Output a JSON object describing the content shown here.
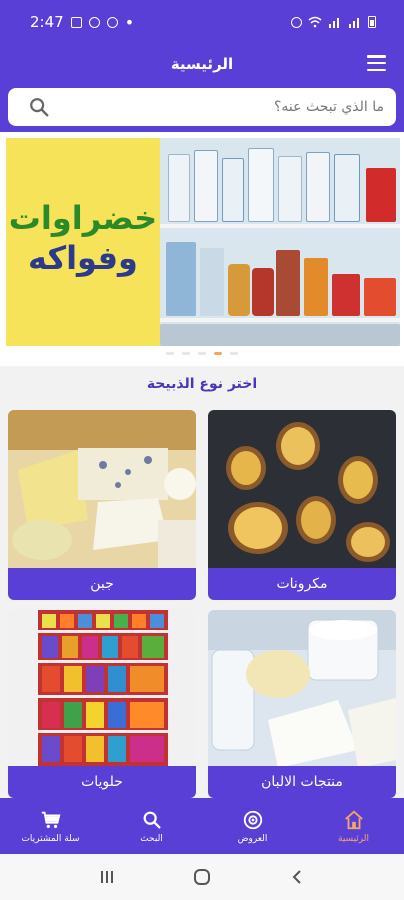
{
  "status_bar": {
    "time": "2:47"
  },
  "header": {
    "title": "الرئيسية"
  },
  "search": {
    "placeholder": "ما الذي تبحث عنه؟"
  },
  "banner": {
    "line1": "خضراوات",
    "line2": "وفواكه",
    "dots_count": 5,
    "active_dot": 4
  },
  "section": {
    "title": "اختر نوع الذبيحة",
    "categories": [
      {
        "label": "جبن"
      },
      {
        "label": "مكرونات"
      },
      {
        "label": "حلويات"
      },
      {
        "label": "منتجات الالبان"
      }
    ]
  },
  "bottom_nav": {
    "items": [
      {
        "label": "الرئيسية",
        "icon": "home-icon",
        "active": true
      },
      {
        "label": "العروض",
        "icon": "offers-icon",
        "active": false
      },
      {
        "label": "البحث",
        "icon": "search-icon",
        "active": false
      },
      {
        "label": "سلة المشتريات",
        "icon": "cart-icon",
        "active": false
      }
    ]
  },
  "colors": {
    "primary": "#5a3fd6",
    "active_nav": "#f4a765",
    "section_title": "#4b35b8"
  }
}
